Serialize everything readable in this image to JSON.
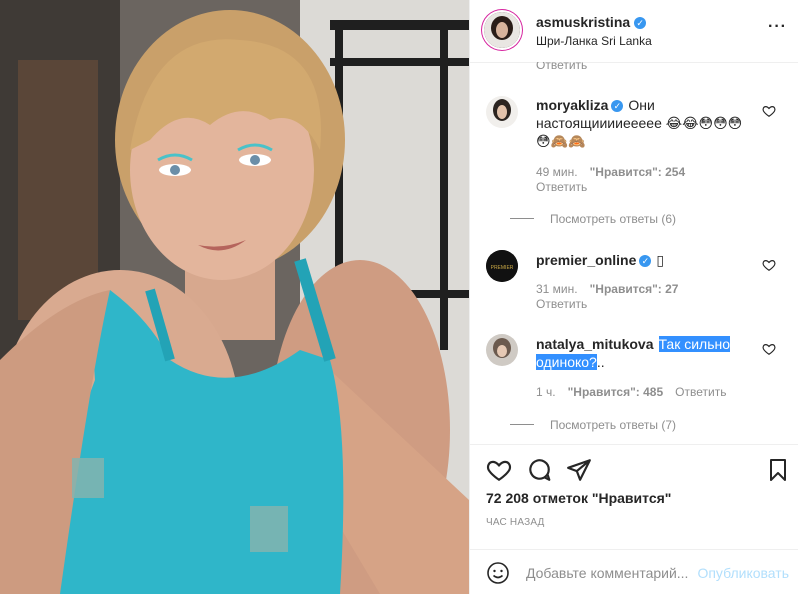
{
  "header": {
    "username": "asmuskristina",
    "location": "Шри-Ланка Sri Lanka",
    "more_label": "···"
  },
  "comments_top_reply": "Ответить",
  "comments": [
    {
      "username": "moryakliza",
      "verified": true,
      "text": "Они настоящииииеееее 😂😂😳😳😳 😳🙈🙈",
      "time": "49 мин.",
      "likes": "\"Нравится\": 254",
      "reply": "Ответить",
      "view_replies": "Посмотреть ответы (6)"
    },
    {
      "username": "premier_online",
      "verified": true,
      "text": "▯",
      "time": "31 мин.",
      "likes": "\"Нравится\": 27",
      "reply": "Ответить"
    },
    {
      "username": "natalya_mitukova",
      "verified": false,
      "text_highlight": "Так сильно одиноко?",
      "text_rest": "..",
      "time": "1 ч.",
      "likes": "\"Нравится\": 485",
      "reply": "Ответить",
      "view_replies": "Посмотреть ответы (7)"
    }
  ],
  "actions": {
    "likes_count": "72 208 отметок \"Нравится\"",
    "timestamp": "ЧАС НАЗАД",
    "comment_placeholder": "Добавьте комментарий...",
    "publish_label": "Опубликовать"
  },
  "colors": {
    "accent": "#3897f0",
    "highlight": "#3390ff",
    "muted": "#8e8e8e",
    "publish_disabled": "#b2dffc",
    "tank_top": "#2fb6c9"
  },
  "icons": [
    "heart-icon",
    "comment-icon",
    "share-icon",
    "bookmark-icon",
    "emoji-icon",
    "more-options-icon",
    "verified-icon"
  ]
}
